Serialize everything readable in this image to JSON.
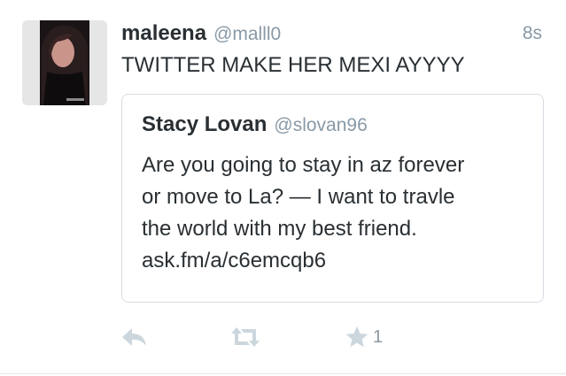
{
  "tweet": {
    "author_name": "maleena",
    "author_handle": "@malll0",
    "timestamp": "8s",
    "text": "TWITTER MAKE HER MEXI AYYYY",
    "avatar_icon": "profile-photo"
  },
  "quote": {
    "author_name": "Stacy Lovan",
    "author_handle": "@slovan96",
    "lines": [
      "Are you going to stay in az forever",
      "or move to La? — I want to travle",
      "the world with my best friend.",
      "ask.fm/a/c6emcqb6"
    ]
  },
  "actions": {
    "reply_icon": "reply-icon",
    "retweet_icon": "retweet-icon",
    "favorite_icon": "star-icon",
    "favorite_count": "1"
  },
  "colors": {
    "text": "#292f33",
    "secondary": "#8899a6",
    "border": "#d6dde3",
    "action_icon": "#ccd6dd"
  }
}
